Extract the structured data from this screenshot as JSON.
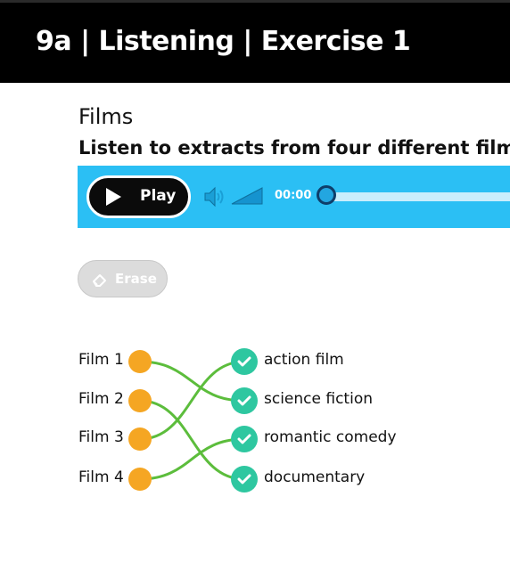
{
  "header": {
    "title": "9a | Listening | Exercise 1"
  },
  "activity": {
    "heading": "Films",
    "instruction": "Listen to extracts from four different films."
  },
  "player": {
    "play_label": "Play",
    "time": "00:00",
    "accent": "#2bbff4"
  },
  "toolbar": {
    "erase_label": "Erase"
  },
  "matching": {
    "films": [
      "Film 1",
      "Film 2",
      "Film 3",
      "Film 4"
    ],
    "options": [
      "action film",
      "science fiction",
      "romantic comedy",
      "documentary"
    ],
    "connections": [
      {
        "film": "Film 1",
        "option": "science fiction"
      },
      {
        "film": "Film 2",
        "option": "documentary"
      },
      {
        "film": "Film 3",
        "option": "action film"
      },
      {
        "film": "Film 4",
        "option": "romantic comedy"
      }
    ],
    "line_color": "#5cbd3c",
    "dot_color": "#f5a623",
    "check_color": "#2ec7a0"
  }
}
